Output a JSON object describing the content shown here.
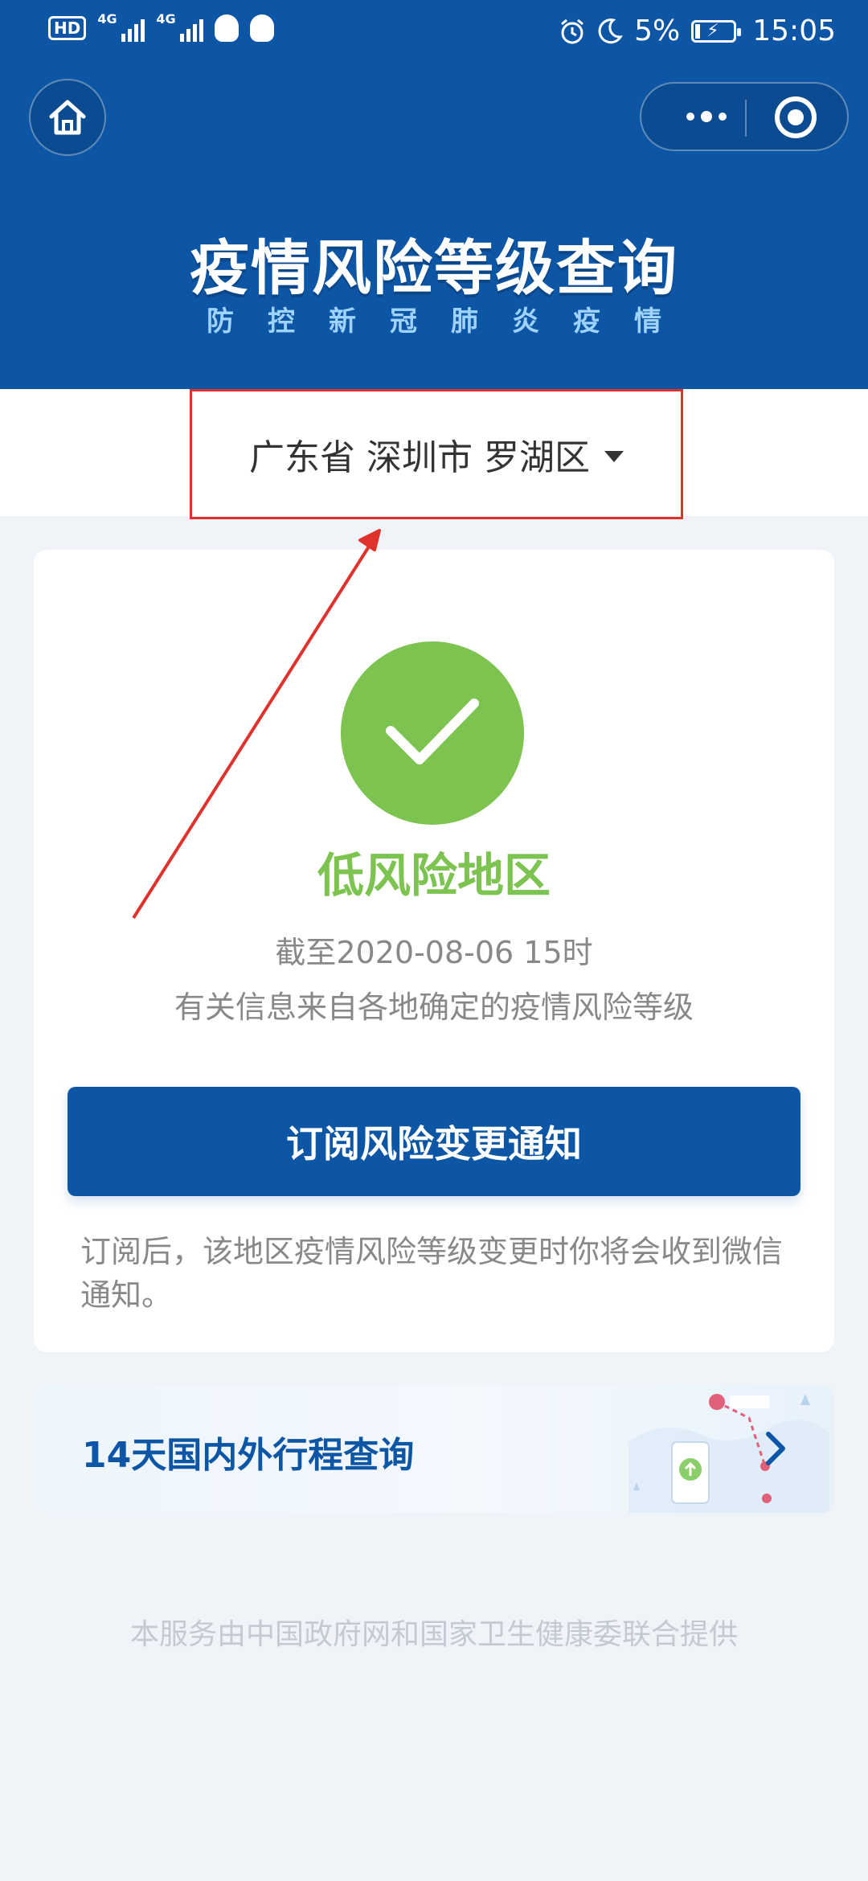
{
  "status_bar": {
    "hd": "HD",
    "sim1_net": "4G",
    "sim2_net": "4G",
    "battery_percent": "5%",
    "time": "15:05",
    "icons": [
      "hd-icon",
      "signal-icon",
      "qq-icon",
      "alarm-icon",
      "moon-icon",
      "battery-icon"
    ]
  },
  "header": {
    "title": "疫情风险等级查询",
    "subtitle": "防控新冠肺炎疫情",
    "background_color": "#0d56a6"
  },
  "region": {
    "province": "广东省",
    "city": "深圳市",
    "district": "罗湖区",
    "display": "广东省 深圳市 罗湖区"
  },
  "status": {
    "risk_level": "低风险地区",
    "as_of": "截至2020-08-06 15时",
    "source_note": "有关信息来自各地确定的疫情风险等级",
    "color": "#7cc350"
  },
  "subscribe": {
    "button_label": "订阅风险变更通知",
    "note": "订阅后，该地区疫情风险等级变更时你将会收到微信通知。"
  },
  "itinerary": {
    "label": "14天国内外行程查询"
  },
  "footer": {
    "text": "本服务由中国政府网和国家卫生健康委联合提供"
  },
  "annotation": {
    "color": "#e0322c"
  }
}
